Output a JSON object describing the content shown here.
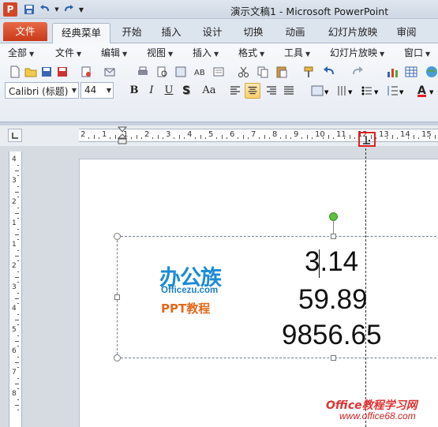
{
  "window": {
    "title": "演示文稿1 - Microsoft PowerPoint",
    "app_icon_letter": "P"
  },
  "ribbon_tabs": [
    {
      "label": "文件"
    },
    {
      "label": "经典菜单"
    },
    {
      "label": "开始"
    },
    {
      "label": "插入"
    },
    {
      "label": "设计"
    },
    {
      "label": "切换"
    },
    {
      "label": "动画"
    },
    {
      "label": "幻灯片放映"
    },
    {
      "label": "审阅"
    }
  ],
  "classic_menu": [
    {
      "label": "全部"
    },
    {
      "label": "文件"
    },
    {
      "label": "编辑"
    },
    {
      "label": "视图"
    },
    {
      "label": "插入"
    },
    {
      "label": "格式"
    },
    {
      "label": "工具"
    },
    {
      "label": "幻灯片放映"
    },
    {
      "label": "窗口"
    }
  ],
  "format_bar": {
    "font_name": "Calibri (标题)",
    "font_size": "44",
    "bold": "B",
    "italic": "I",
    "underline": "U",
    "change_case": "Aa"
  },
  "ruler": {
    "h_labels": [
      "2",
      "1",
      "1",
      "2",
      "3",
      "4",
      "5",
      "6",
      "7",
      "8",
      "9",
      "10",
      "11",
      "12",
      "13",
      "14",
      "15"
    ],
    "v_labels": [
      "4",
      "3",
      "2",
      "1",
      "1",
      "2",
      "3",
      "4",
      "5",
      "6",
      "7",
      "8"
    ]
  },
  "slide": {
    "numbers": [
      "3.14",
      "59.89",
      "9856.65"
    ],
    "logo_cn": "办公族",
    "logo_url": "Officezu.com",
    "logo_ppt": "PPT教程"
  },
  "watermark": {
    "title": "Office教程学习网",
    "url": "www.office68.com"
  },
  "colors": {
    "file_tab": "#d24726",
    "selected_button": "#f8cf6e",
    "logo_blue": "#1a8bd6",
    "logo_orange": "#e2691c",
    "highlight_red": "#e02020"
  }
}
